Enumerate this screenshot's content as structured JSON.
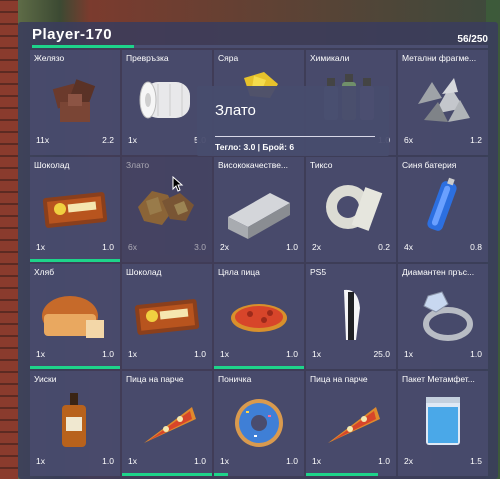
{
  "inventory": {
    "player_name": "Player-170",
    "weight_text": "56/250",
    "weight_fraction": 0.224,
    "accent_color": "#1ed48a"
  },
  "slots": [
    {
      "name": "Желязо",
      "count": "11x",
      "weight": "2.2",
      "icon": "iron-ore-icon",
      "durability": 0
    },
    {
      "name": "Превръзка",
      "count": "1x",
      "weight": "5.0",
      "icon": "bandage-icon",
      "durability": 0
    },
    {
      "name": "Сяра",
      "count": "",
      "weight": "",
      "icon": "sulfur-icon",
      "durability": 0
    },
    {
      "name": "Химикали",
      "count": "",
      "weight": "1.0",
      "icon": "chemicals-icon",
      "durability": 0
    },
    {
      "name": "Метални фрагме...",
      "count": "6x",
      "weight": "1.2",
      "icon": "metal-fragments-icon",
      "durability": 0
    },
    {
      "name": "Шоколад",
      "count": "1x",
      "weight": "1.0",
      "icon": "chocolate-bar-icon",
      "durability": 1.0
    },
    {
      "name": "Злато",
      "count": "6x",
      "weight": "3.0",
      "icon": "gold-ore-icon",
      "durability": 0
    },
    {
      "name": "Висококачестве...",
      "count": "2x",
      "weight": "1.0",
      "icon": "steel-bar-icon",
      "durability": 0
    },
    {
      "name": "Тиксо",
      "count": "2x",
      "weight": "0.2",
      "icon": "duct-tape-icon",
      "durability": 0
    },
    {
      "name": "Синя батерия",
      "count": "4x",
      "weight": "0.8",
      "icon": "blue-battery-icon",
      "durability": 0
    },
    {
      "name": "Хляб",
      "count": "1x",
      "weight": "1.0",
      "icon": "bread-icon",
      "durability": 1.0
    },
    {
      "name": "Шоколад",
      "count": "1x",
      "weight": "1.0",
      "icon": "chocolate-bar-icon",
      "durability": 0
    },
    {
      "name": "Цяла пица",
      "count": "1x",
      "weight": "1.0",
      "icon": "pizza-icon",
      "durability": 1.0
    },
    {
      "name": "PS5",
      "count": "1x",
      "weight": "25.0",
      "icon": "ps5-console-icon",
      "durability": 0
    },
    {
      "name": "Диамантен пръс...",
      "count": "1x",
      "weight": "1.0",
      "icon": "diamond-ring-icon",
      "durability": 0
    },
    {
      "name": "Уиски",
      "count": "1x",
      "weight": "1.0",
      "icon": "whiskey-bottle-icon",
      "durability": 0
    },
    {
      "name": "Пица на парче",
      "count": "1x",
      "weight": "1.0",
      "icon": "pizza-slice-icon",
      "durability": 1.0
    },
    {
      "name": "Поничка",
      "count": "1x",
      "weight": "1.0",
      "icon": "donut-icon",
      "durability": 0.15
    },
    {
      "name": "Пица на парче",
      "count": "1x",
      "weight": "1.0",
      "icon": "pizza-slice-icon",
      "durability": 0.8
    },
    {
      "name": "Пакет Метамфет...",
      "count": "2x",
      "weight": "1.5",
      "icon": "meth-bag-icon",
      "durability": 0
    }
  ],
  "tooltip": {
    "item_name": "Злато",
    "info": "Тегло: 3.0 | Брой: 6"
  }
}
